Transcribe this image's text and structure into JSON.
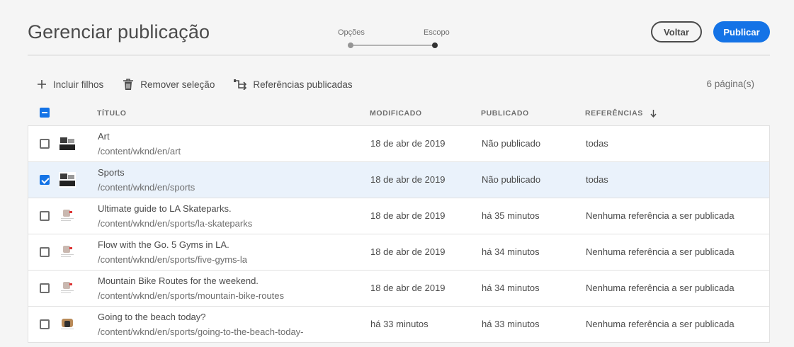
{
  "header": {
    "title": "Gerenciar publicação",
    "steps": [
      "Opções",
      "Escopo"
    ],
    "back_label": "Voltar",
    "publish_label": "Publicar"
  },
  "toolbar": {
    "include_children": "Incluir filhos",
    "remove_selection": "Remover seleção",
    "published_references": "Referências publicadas",
    "page_count": "6 página(s)"
  },
  "table": {
    "columns": {
      "title": "TÍTULO",
      "modified": "MODIFICADO",
      "published": "PUBLICADO",
      "references": "REFERÊNCIAS"
    },
    "rows": [
      {
        "title": "Art",
        "path": "/content/wknd/en/art",
        "modified": "18 de abr de 2019",
        "published": "Não publicado",
        "references": "todas",
        "selected": false,
        "thumb": "dark"
      },
      {
        "title": "Sports",
        "path": "/content/wknd/en/sports",
        "modified": "18 de abr de 2019",
        "published": "Não publicado",
        "references": "todas",
        "selected": true,
        "thumb": "dark"
      },
      {
        "title": "Ultimate guide to LA Skateparks.",
        "path": "/content/wknd/en/sports/la-skateparks",
        "modified": "18 de abr de 2019",
        "published": "há 35 minutos",
        "references": "Nenhuma referência a ser publicada",
        "selected": false,
        "thumb": "light"
      },
      {
        "title": "Flow with the Go. 5 Gyms in LA.",
        "path": "/content/wknd/en/sports/five-gyms-la",
        "modified": "18 de abr de 2019",
        "published": "há 34 minutos",
        "references": "Nenhuma referência a ser publicada",
        "selected": false,
        "thumb": "light"
      },
      {
        "title": "Mountain Bike Routes for the weekend.",
        "path": "/content/wknd/en/sports/mountain-bike-routes",
        "modified": "18 de abr de 2019",
        "published": "há 34 minutos",
        "references": "Nenhuma referência a ser publicada",
        "selected": false,
        "thumb": "light"
      },
      {
        "title": "Going to the beach today?",
        "path": "/content/wknd/en/sports/going-to-the-beach-today-",
        "modified": "há 33 minutos",
        "published": "há 33 minutos",
        "references": "Nenhuma referência a ser publicada",
        "selected": false,
        "thumb": "beach"
      }
    ]
  },
  "colors": {
    "accent": "#1473e6",
    "selected_row": "#eaf2fb",
    "background": "#f5f5f5"
  },
  "icons": [
    "plus-icon",
    "trash-icon",
    "references-icon",
    "sort-descending-icon"
  ]
}
